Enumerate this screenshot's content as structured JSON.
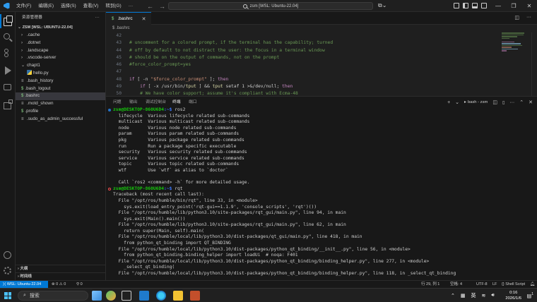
{
  "titlebar": {
    "menus": [
      "文件(F)",
      "编辑(E)",
      "选择(S)",
      "查看(V)",
      "转到(G)"
    ],
    "more": "···",
    "command_center": "zsm [WSL: Ubuntu-22.04]"
  },
  "sidebar": {
    "title": "资源管理器",
    "more": "···",
    "workspace": "ZSM [WSL: UBUNTU-22.04]",
    "items": [
      {
        "label": ".cache",
        "type": "folder",
        "indent": 0
      },
      {
        "label": ".dotnet",
        "type": "folder",
        "indent": 0
      },
      {
        "label": ".landscape",
        "type": "folder",
        "indent": 0
      },
      {
        "label": ".vscode-server",
        "type": "folder",
        "indent": 0
      },
      {
        "label": "chapt1",
        "type": "folder-open",
        "indent": 0
      },
      {
        "label": "hello.py",
        "type": "python",
        "indent": 1
      },
      {
        "label": ".bash_history",
        "type": "file",
        "indent": 0
      },
      {
        "label": ".bash_logout",
        "type": "shell",
        "indent": 0
      },
      {
        "label": ".bashrc",
        "type": "shell",
        "indent": 0,
        "selected": true
      },
      {
        "label": ".motd_shown",
        "type": "file",
        "indent": 0
      },
      {
        "label": ".profile",
        "type": "shell",
        "indent": 0
      },
      {
        "label": ".sudo_as_admin_successful",
        "type": "file",
        "indent": 0
      }
    ],
    "outline": "大纲",
    "timeline": "时间线"
  },
  "editor": {
    "tab_label": ".bashrc",
    "tab_icon": "$",
    "breadcrumb": "$ .bashrc",
    "lines": [
      {
        "n": "42",
        "text": ""
      },
      {
        "n": "43",
        "text": "# uncomment for a colored prompt, if the terminal has the capability; turned"
      },
      {
        "n": "44",
        "text": "# off by default to not distract the user: the focus in a terminal window"
      },
      {
        "n": "45",
        "text": "# should be on the output of commands, not on the prompt"
      },
      {
        "n": "46",
        "text": "#force_color_prompt=yes"
      },
      {
        "n": "47",
        "text": ""
      },
      {
        "n": "48",
        "text": "if [ -n \"$force_color_prompt\" ]; then"
      },
      {
        "n": "49",
        "text": "    if [ -x /usr/bin/tput ] && tput setaf 1 >&/dev/null; then"
      },
      {
        "n": "50",
        "text": "    # We have color support; assume it's compliant with Ecma-48"
      }
    ]
  },
  "panel": {
    "tabs": [
      "问题",
      "输出",
      "调试控制台",
      "终端",
      "端口"
    ],
    "active_tab": "终端",
    "terminal_name": "bash - zsm",
    "actions": {
      "add": "+",
      "dropdown": "⌄",
      "split": "◫",
      "trash": "🗑",
      "more": "···",
      "maximize": "⌃",
      "close": "✕"
    }
  },
  "terminal": {
    "lines": [
      {
        "kind": "prompt",
        "user": "zsm@DESKTOP-860U6D4",
        "path": ":~$",
        "cmd": " ros2",
        "dot": "blue"
      },
      {
        "kind": "text",
        "text": "  lifecycle  Various lifecycle related sub-commands"
      },
      {
        "kind": "text",
        "text": "  multicast  Various multicast related sub-commands"
      },
      {
        "kind": "text",
        "text": "  node       Various node related sub-commands"
      },
      {
        "kind": "text",
        "text": "  param      Various param related sub-commands"
      },
      {
        "kind": "text",
        "text": "  pkg        Various package related sub-commands"
      },
      {
        "kind": "text",
        "text": "  run        Run a package specific executable"
      },
      {
        "kind": "text",
        "text": "  security   Various security related sub-commands"
      },
      {
        "kind": "text",
        "text": "  service    Various service related sub-commands"
      },
      {
        "kind": "text",
        "text": "  topic      Various topic related sub-commands"
      },
      {
        "kind": "text",
        "text": "  wtf        Use `wtf` as alias to `doctor`"
      },
      {
        "kind": "text",
        "text": ""
      },
      {
        "kind": "text",
        "text": "  Call `ros2 <command> -h` for more detailed usage."
      },
      {
        "kind": "prompt",
        "user": "zsm@DESKTOP-860U6D4",
        "path": ":~$",
        "cmd": " rqt",
        "dot": "red"
      },
      {
        "kind": "text",
        "text": "Traceback (most recent call last):"
      },
      {
        "kind": "text",
        "text": "  File \"/opt/ros/humble/bin/rqt\", line 33, in <module>"
      },
      {
        "kind": "text",
        "text": "    sys.exit(load_entry_point('rqt-gui==1.1.9', 'console_scripts', 'rqt')())"
      },
      {
        "kind": "text",
        "text": "  File \"/opt/ros/humble/lib/python3.10/site-packages/rqt_gui/main.py\", line 94, in main"
      },
      {
        "kind": "text",
        "text": "    sys.exit(Main().main())"
      },
      {
        "kind": "text",
        "text": "  File \"/opt/ros/humble/lib/python3.10/site-packages/rqt_gui/main.py\", line 62, in main"
      },
      {
        "kind": "text",
        "text": "    return super(Main, self).main("
      },
      {
        "kind": "text",
        "text": "  File \"/opt/ros/humble/local/lib/python3.10/dist-packages/qt_gui/main.py\", line 418, in main"
      },
      {
        "kind": "text",
        "text": "    from python_qt_binding import QT_BINDING"
      },
      {
        "kind": "text",
        "text": "  File \"/opt/ros/humble/local/lib/python3.10/dist-packages/python_qt_binding/__init__.py\", line 56, in <module>"
      },
      {
        "kind": "text",
        "text": "    from python_qt_binding.binding_helper import loadUi  # noqa: F401"
      },
      {
        "kind": "text",
        "text": "  File \"/opt/ros/humble/local/lib/python3.10/dist-packages/python_qt_binding/binding_helper.py\", line 277, in <module>"
      },
      {
        "kind": "text",
        "text": "    _select_qt_binding("
      },
      {
        "kind": "text",
        "text": "  File \"/opt/ros/humble/local/lib/python3.10/dist-packages/python_qt_binding/binding_helper.py\", line 118, in _select_qt_binding"
      }
    ]
  },
  "statusbar": {
    "remote": "WSL: Ubuntu-22.04",
    "errors": "0",
    "warnings": "0",
    "ports": "0",
    "position": "行 29, 列 1",
    "spaces": "空格: 4",
    "encoding": "UTF-8",
    "eol": "LF",
    "language": "Shell Script"
  },
  "taskbar": {
    "search_placeholder": "搜索",
    "ime": "英",
    "time": "0:16",
    "date": "2026/1/6",
    "notifications": "1"
  },
  "colors": {
    "accent": "#0078d4",
    "prompt_green": "#16c60c",
    "prompt_blue": "#3b78ff",
    "comment": "#6a9955"
  }
}
